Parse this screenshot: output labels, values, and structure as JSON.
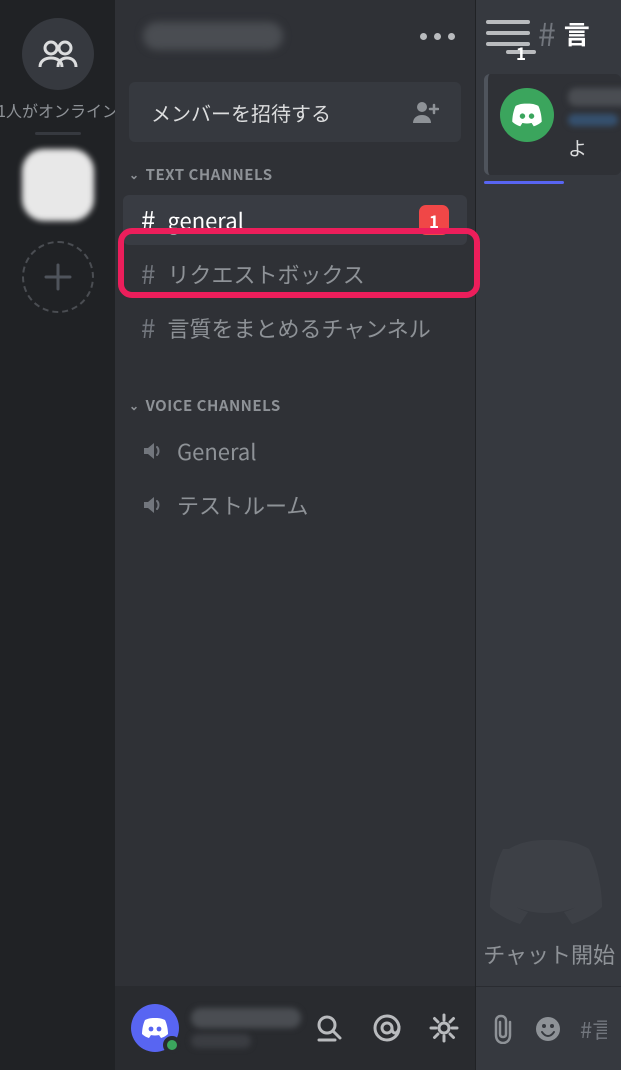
{
  "rail": {
    "online_text": "1人がオンライン"
  },
  "server": {
    "invite_label": "メンバーを招待する",
    "text_category": "TEXT CHANNELS",
    "voice_category": "VOICE CHANNELS",
    "text_channels": [
      {
        "name": "general",
        "badge": "1",
        "selected": true
      },
      {
        "name": "リクエストボックス"
      },
      {
        "name": "言質をまとめるチャンネル"
      }
    ],
    "voice_channels": [
      {
        "name": "General"
      },
      {
        "name": "テストルーム"
      }
    ]
  },
  "peek": {
    "burger_badge": "1",
    "channel_prefix": "#",
    "channel_name": "言",
    "embed_line3": "よ",
    "chat_start": "チャット開始",
    "input_placeholder": "#言"
  }
}
